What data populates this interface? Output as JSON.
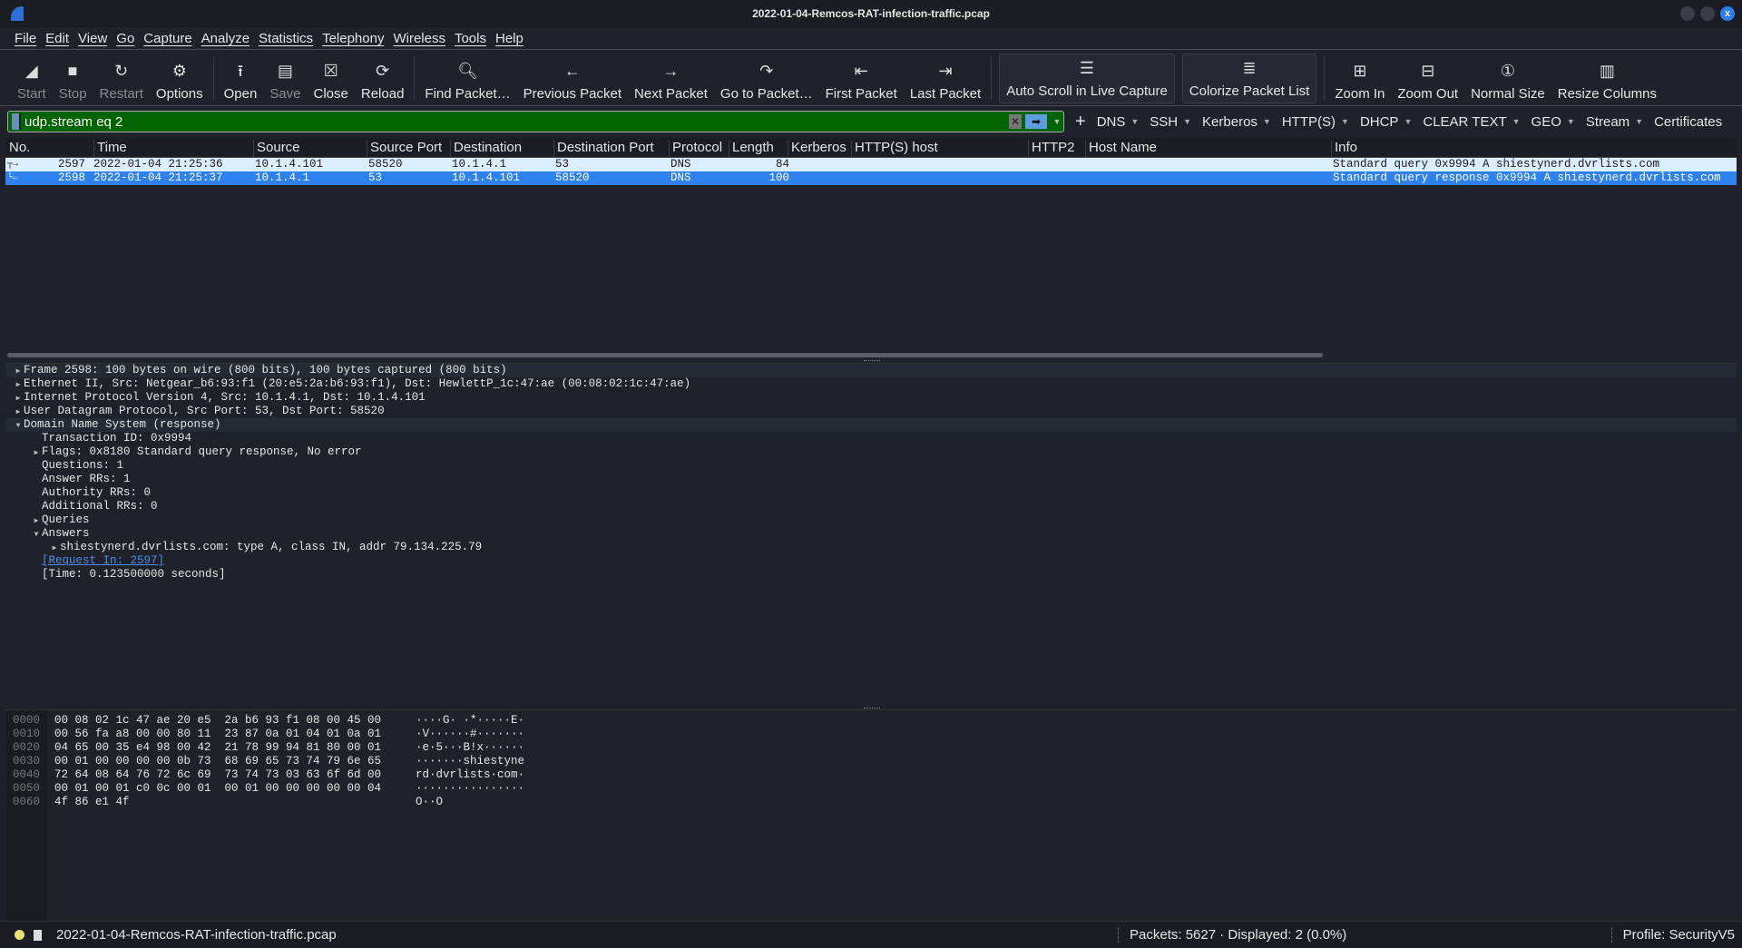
{
  "window": {
    "title": "2022-01-04-Remcos-RAT-infection-traffic.pcap",
    "close_glyph": "x"
  },
  "menu": [
    "File",
    "Edit",
    "View",
    "Go",
    "Capture",
    "Analyze",
    "Statistics",
    "Telephony",
    "Wireless",
    "Tools",
    "Help"
  ],
  "toolbar": [
    {
      "label": "Start",
      "icon": "shark-fin-icon",
      "disabled": true
    },
    {
      "label": "Stop",
      "icon": "stop-icon",
      "disabled": true
    },
    {
      "label": "Restart",
      "icon": "restart-icon",
      "disabled": true
    },
    {
      "label": "Options",
      "icon": "gear-icon",
      "disabled": false
    },
    {
      "label": "Open",
      "icon": "open-icon",
      "disabled": false
    },
    {
      "label": "Save",
      "icon": "save-icon",
      "disabled": true
    },
    {
      "label": "Close",
      "icon": "close-file-icon",
      "disabled": false
    },
    {
      "label": "Reload",
      "icon": "reload-icon",
      "disabled": false
    },
    {
      "label": "Find Packet…",
      "icon": "search-icon",
      "disabled": false
    },
    {
      "label": "Previous Packet",
      "icon": "arrow-left-icon",
      "disabled": false
    },
    {
      "label": "Next Packet",
      "icon": "arrow-right-icon",
      "disabled": false
    },
    {
      "label": "Go to Packet…",
      "icon": "goto-icon",
      "disabled": false
    },
    {
      "label": "First Packet",
      "icon": "first-icon",
      "disabled": false
    },
    {
      "label": "Last Packet",
      "icon": "last-icon",
      "disabled": false
    },
    {
      "label": "Auto Scroll in Live Capture",
      "icon": "autoscroll-icon",
      "disabled": false,
      "boxed": true
    },
    {
      "label": "Colorize Packet List",
      "icon": "colorize-icon",
      "disabled": false,
      "boxed": true
    },
    {
      "label": "Zoom In",
      "icon": "zoom-in-icon",
      "disabled": false
    },
    {
      "label": "Zoom Out",
      "icon": "zoom-out-icon",
      "disabled": false
    },
    {
      "label": "Normal Size",
      "icon": "normal-size-icon",
      "disabled": false
    },
    {
      "label": "Resize Columns",
      "icon": "resize-columns-icon",
      "disabled": false
    }
  ],
  "filter": {
    "value": "udp.stream eq 2",
    "color": "#006400"
  },
  "filter_buttons": [
    {
      "label": "DNS",
      "menu": true
    },
    {
      "label": "SSH",
      "menu": true
    },
    {
      "label": "Kerberos",
      "menu": true
    },
    {
      "label": "HTTP(S)",
      "menu": true
    },
    {
      "label": "DHCP",
      "menu": true
    },
    {
      "label": "CLEAR TEXT",
      "menu": true
    },
    {
      "label": "GEO",
      "menu": true
    },
    {
      "label": "Stream",
      "menu": true
    },
    {
      "label": "Certificates",
      "menu": false
    }
  ],
  "packet_list": {
    "columns": [
      "No.",
      "Time",
      "Source",
      "Source Port",
      "Destination",
      "Destination Port",
      "Protocol",
      "Length",
      "Kerberos",
      "HTTP(S) host",
      "HTTP2",
      "Host Name",
      "Info"
    ],
    "rows": [
      {
        "no": "2597",
        "time": "2022-01-04 21:25:36",
        "source": "10.1.4.101",
        "sport": "58520",
        "destination": "10.1.4.1",
        "dport": "53",
        "protocol": "DNS",
        "length": "84",
        "info": "Standard query 0x9994 A shiestynerd.dvrlists.com"
      },
      {
        "no": "2598",
        "time": "2022-01-04 21:25:37",
        "source": "10.1.4.1",
        "sport": "53",
        "destination": "10.1.4.101",
        "dport": "58520",
        "protocol": "DNS",
        "length": "100",
        "info": "Standard query response 0x9994 A shiestynerd.dvrlists.com",
        "selected": true
      }
    ]
  },
  "details": [
    {
      "indent": 0,
      "tw": "closed",
      "text": "Frame 2598: 100 bytes on wire (800 bits), 100 bytes captured (800 bits)",
      "sel": true
    },
    {
      "indent": 0,
      "tw": "closed",
      "text": "Ethernet II, Src: Netgear_b6:93:f1 (20:e5:2a:b6:93:f1), Dst: HewlettP_1c:47:ae (00:08:02:1c:47:ae)"
    },
    {
      "indent": 0,
      "tw": "closed",
      "text": "Internet Protocol Version 4, Src: 10.1.4.1, Dst: 10.1.4.101"
    },
    {
      "indent": 0,
      "tw": "closed",
      "text": "User Datagram Protocol, Src Port: 53, Dst Port: 58520"
    },
    {
      "indent": 0,
      "tw": "open",
      "text": "Domain Name System (response)",
      "sel": true
    },
    {
      "indent": 1,
      "tw": "none",
      "text": "Transaction ID: 0x9994"
    },
    {
      "indent": 1,
      "tw": "closed",
      "text": "Flags: 0x8180 Standard query response, No error"
    },
    {
      "indent": 1,
      "tw": "none",
      "text": "Questions: 1"
    },
    {
      "indent": 1,
      "tw": "none",
      "text": "Answer RRs: 1"
    },
    {
      "indent": 1,
      "tw": "none",
      "text": "Authority RRs: 0"
    },
    {
      "indent": 1,
      "tw": "none",
      "text": "Additional RRs: 0"
    },
    {
      "indent": 1,
      "tw": "closed",
      "text": "Queries"
    },
    {
      "indent": 1,
      "tw": "open",
      "text": "Answers"
    },
    {
      "indent": 2,
      "tw": "closed",
      "text": "shiestynerd.dvrlists.com: type A, class IN, addr 79.134.225.79"
    },
    {
      "indent": 1,
      "tw": "none",
      "text": "[Request In: 2597]",
      "link": true
    },
    {
      "indent": 1,
      "tw": "none",
      "text": "[Time: 0.123500000 seconds]"
    }
  ],
  "hex": [
    {
      "off": "0000",
      "bytes": "00 08 02 1c 47 ae 20 e5  2a b6 93 f1 08 00 45 00",
      "ascii": "····G· ·*·····E·"
    },
    {
      "off": "0010",
      "bytes": "00 56 fa a8 00 00 80 11  23 87 0a 01 04 01 0a 01",
      "ascii": "·V······#·······"
    },
    {
      "off": "0020",
      "bytes": "04 65 00 35 e4 98 00 42  21 78 99 94 81 80 00 01",
      "ascii": "·e·5···B!x······"
    },
    {
      "off": "0030",
      "bytes": "00 01 00 00 00 00 0b 73  68 69 65 73 74 79 6e 65",
      "ascii": "·······shiestyne"
    },
    {
      "off": "0040",
      "bytes": "72 64 08 64 76 72 6c 69  73 74 73 03 63 6f 6d 00",
      "ascii": "rd·dvrlists·com·"
    },
    {
      "off": "0050",
      "bytes": "00 01 00 01 c0 0c 00 01  00 01 00 00 00 00 00 04",
      "ascii": "················"
    },
    {
      "off": "0060",
      "bytes": "4f 86 e1 4f",
      "ascii": "O··O"
    }
  ],
  "status": {
    "file": "2022-01-04-Remcos-RAT-infection-traffic.pcap",
    "packets": "Packets: 5627 · Displayed: 2 (0.0%)",
    "profile": "Profile: SecurityV5"
  }
}
